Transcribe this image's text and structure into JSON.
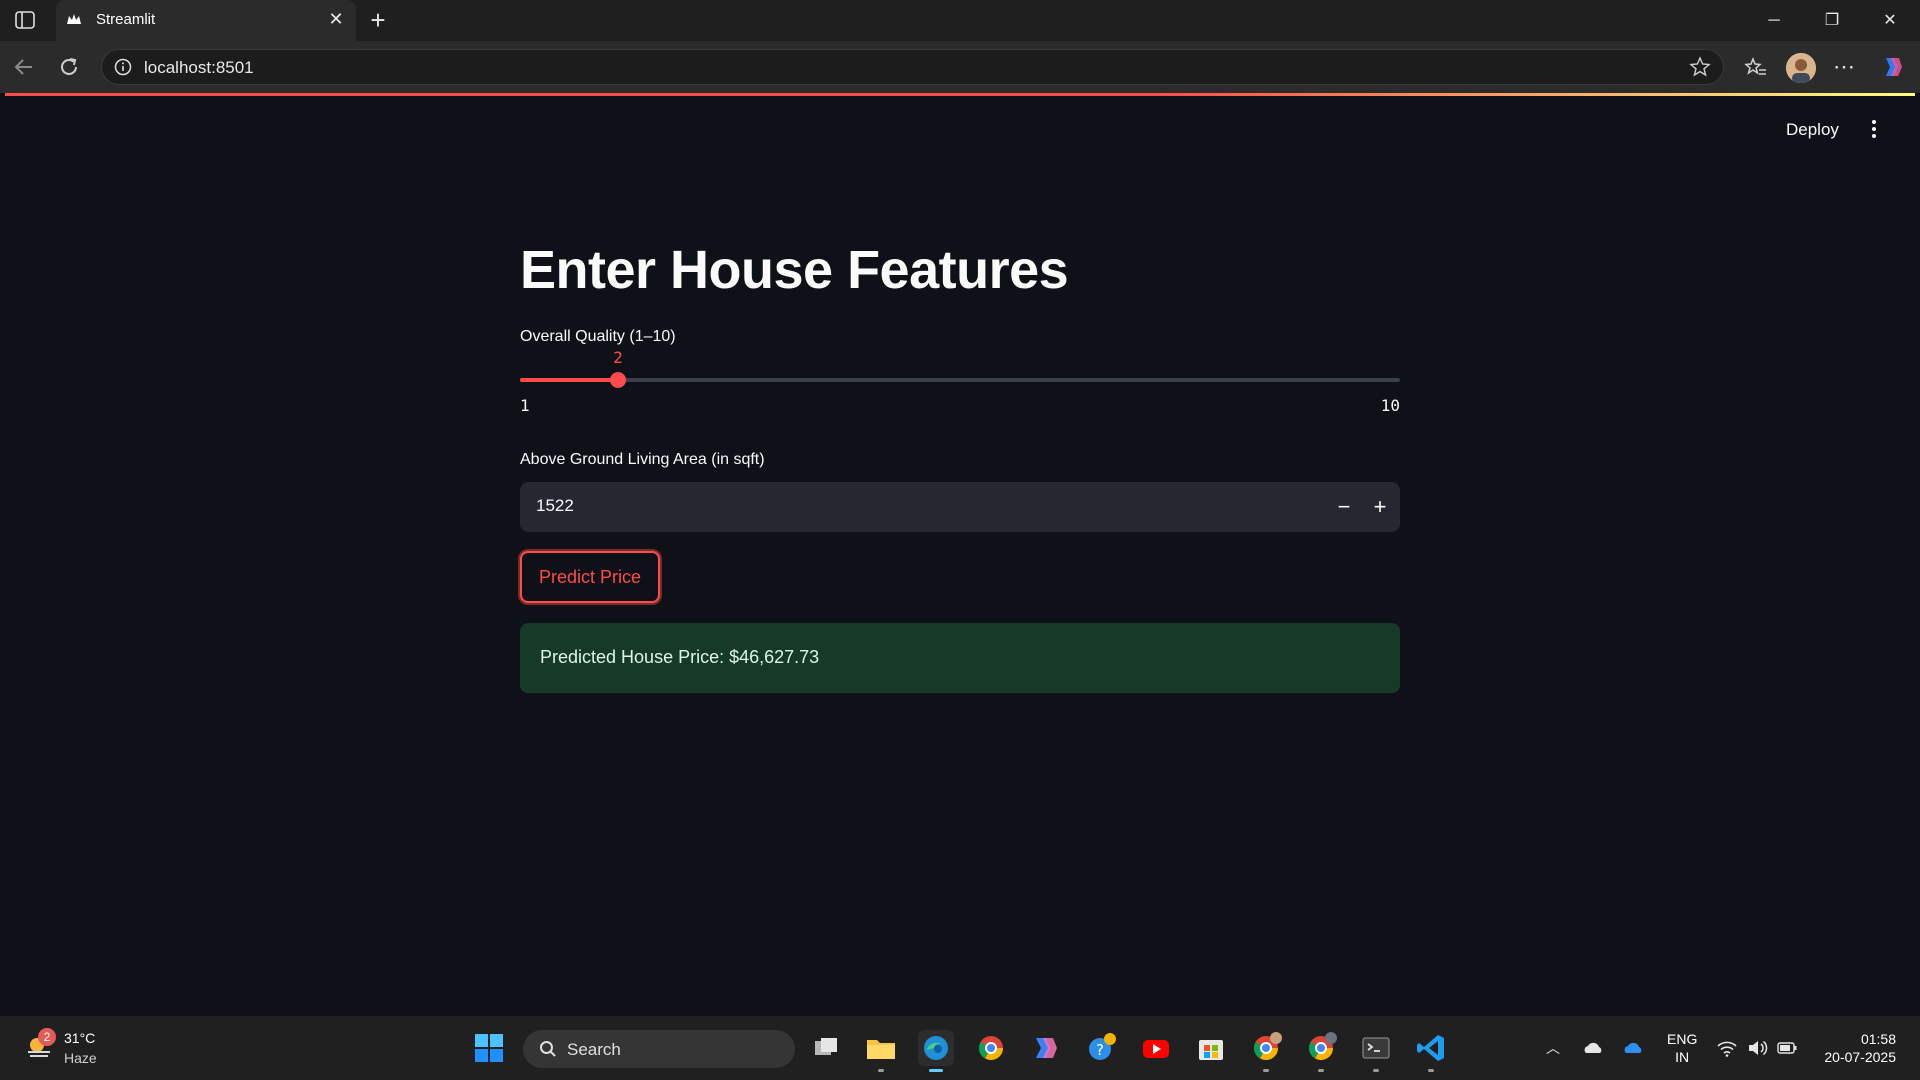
{
  "browser": {
    "tab_title": "Streamlit",
    "new_tab": "+",
    "url": "localhost:8501",
    "window_controls": {
      "minimize": "─",
      "restore": "❐",
      "close": "✕"
    }
  },
  "app": {
    "deploy_label": "Deploy",
    "title": "Enter House Features",
    "slider": {
      "label": "Overall Quality (1–10)",
      "value": 2,
      "min": 1,
      "max": 10,
      "value_text": "2",
      "min_text": "1",
      "max_text": "10"
    },
    "number_input": {
      "label": "Above Ground Living Area (in sqft)",
      "value": "1522",
      "minus": "−",
      "plus": "+"
    },
    "predict_button": "Predict Price",
    "result": "Predicted House Price: $46,627.73",
    "accent_color": "#ff4b4b",
    "success_bg": "#173928"
  },
  "taskbar": {
    "weather": {
      "badge": "2",
      "temp": "31°C",
      "condition": "Haze"
    },
    "search_placeholder": "Search",
    "apps": [
      "task-view",
      "file-explorer",
      "edge",
      "chrome",
      "copilot",
      "help",
      "youtube",
      "store",
      "chrome-profile-1",
      "chrome-profile-2",
      "terminal",
      "vscode"
    ],
    "lang_line1": "ENG",
    "lang_line2": "IN",
    "time": "01:58",
    "date": "20-07-2025"
  }
}
